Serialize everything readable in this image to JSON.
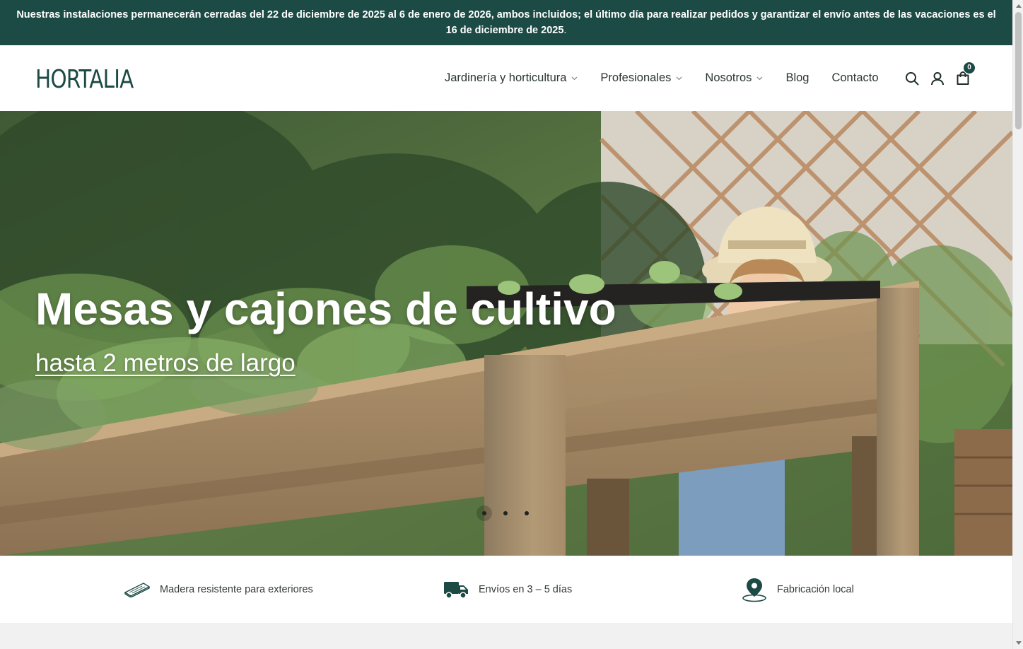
{
  "announcement": {
    "text": "Nuestras instalaciones permanecerán cerradas del 22 de diciembre de 2025 al 6 de enero de 2026, ambos incluidos; el último día para realizar pedidos y garantizar el envío antes de las vacaciones es el 16 de diciembre de 2025",
    "end": "."
  },
  "header": {
    "logo": "HORTALIA",
    "nav": [
      {
        "label": "Jardinería y horticultura",
        "dropdown": true
      },
      {
        "label": "Profesionales",
        "dropdown": true
      },
      {
        "label": "Nosotros",
        "dropdown": true
      },
      {
        "label": "Blog",
        "dropdown": false
      },
      {
        "label": "Contacto",
        "dropdown": false
      }
    ],
    "icons": [
      "search-icon",
      "account-icon",
      "cart-icon"
    ],
    "cart_count": "0"
  },
  "hero": {
    "title": "Mesas y cajones de cultivo",
    "link": "hasta 2 metros de largo",
    "slides": 3,
    "active_slide": 1
  },
  "features": [
    {
      "icon": "wood-plank-icon",
      "label": "Madera resistente para exteriores"
    },
    {
      "icon": "truck-icon",
      "label": "Envíos en 3 – 5 días"
    },
    {
      "icon": "location-pin-icon",
      "label": "Fabricación local"
    }
  ],
  "colors": {
    "brand": "#1c4a45",
    "text": "#2a3532"
  }
}
